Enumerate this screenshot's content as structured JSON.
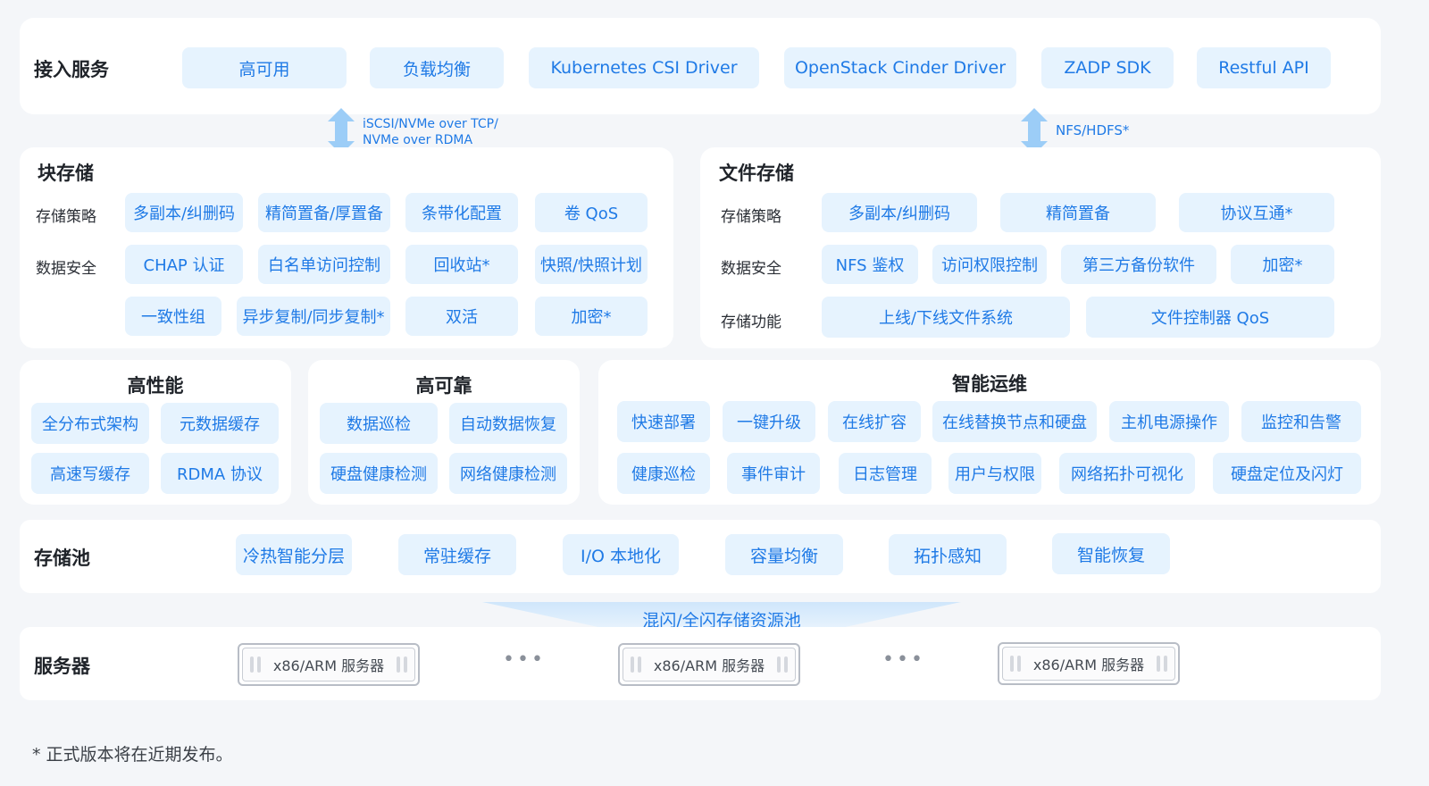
{
  "colors": {
    "accent": "#1f7ae6",
    "pill_bg": "#e6f3fe",
    "panel_bg": "#ffffff",
    "page_bg": "#f4f6f9"
  },
  "access": {
    "title": "接入服务",
    "items": [
      "高可用",
      "负载均衡",
      "Kubernetes CSI Driver",
      "OpenStack Cinder Driver",
      "ZADP SDK",
      "Restful API"
    ]
  },
  "protocols": {
    "block": [
      "iSCSI/NVMe over TCP/",
      "NVMe over RDMA"
    ],
    "file": "NFS/HDFS*"
  },
  "block": {
    "title": "块存储",
    "policy_label": "存储策略",
    "security_label": "数据安全",
    "policy": [
      "多副本/纠删码",
      "精简置备/厚置备",
      "条带化配置",
      "卷 QoS"
    ],
    "security": [
      "CHAP 认证",
      "白名单访问控制",
      "回收站*",
      "快照/快照计划"
    ],
    "security2": [
      "一致性组",
      "异步复制/同步复制*",
      "双活",
      "加密*"
    ]
  },
  "file": {
    "title": "文件存储",
    "policy_label": "存储策略",
    "security_label": "数据安全",
    "function_label": "存储功能",
    "policy": [
      "多副本/纠删码",
      "精简置备",
      "协议互通*"
    ],
    "security": [
      "NFS 鉴权",
      "访问权限控制",
      "第三方备份软件",
      "加密*"
    ],
    "functions": [
      "上线/下线文件系统",
      "文件控制器 QoS"
    ]
  },
  "performance": {
    "title": "高性能",
    "items": [
      "全分布式架构",
      "元数据缓存",
      "高速写缓存",
      "RDMA 协议"
    ]
  },
  "reliability": {
    "title": "高可靠",
    "items": [
      "数据巡检",
      "自动数据恢复",
      "硬盘健康检测",
      "网络健康检测"
    ]
  },
  "ops": {
    "title": "智能运维",
    "row1": [
      "快速部署",
      "一键升级",
      "在线扩容",
      "在线替换节点和硬盘",
      "主机电源操作",
      "监控和告警"
    ],
    "row2": [
      "健康巡检",
      "事件审计",
      "日志管理",
      "用户与权限",
      "网络拓扑可视化",
      "硬盘定位及闪灯"
    ]
  },
  "pool": {
    "title": "存储池",
    "items": [
      "冷热智能分层",
      "常驻缓存",
      "I/O 本地化",
      "容量均衡",
      "拓扑感知",
      "智能恢复"
    ],
    "resource_label": "混闪/全闪存储资源池"
  },
  "servers": {
    "title": "服务器",
    "items": [
      "x86/ARM 服务器",
      "x86/ARM 服务器",
      "x86/ARM 服务器"
    ],
    "ellipsis": "•••"
  },
  "footnote": "* 正式版本将在近期发布。"
}
